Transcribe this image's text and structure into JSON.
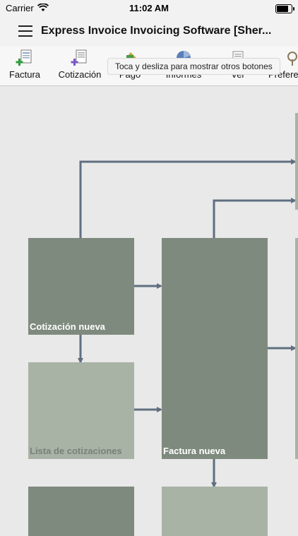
{
  "status_bar": {
    "carrier": "Carrier",
    "time": "11:02 AM",
    "battery_level": 0.9
  },
  "app": {
    "title": "Express Invoice Invoicing Software [Sher..."
  },
  "toolbar": {
    "buttons": [
      {
        "label": "Factura",
        "icon": "invoice-plus-icon"
      },
      {
        "label": "Cotización",
        "icon": "quote-plus-icon"
      },
      {
        "label": "Pago",
        "icon": "payment-icon"
      },
      {
        "label": "Informes",
        "icon": "reports-icon"
      },
      {
        "label": "Ver",
        "icon": "view-icon"
      },
      {
        "label": "Prefere",
        "icon": "preferences-icon"
      }
    ],
    "tooltip": "Toca y desliza para mostrar otros botones"
  },
  "flow": {
    "nodes": [
      {
        "label": "Cotización nueva",
        "style": "dark"
      },
      {
        "label": "Lista de cotizaciones",
        "style": "light"
      },
      {
        "label": "Factura nueva",
        "style": "dark"
      }
    ]
  },
  "colors": {
    "dark_node": "#7e8a7d",
    "light_node": "#a8b3a6",
    "connector": "#5f6f80",
    "background": "#e9e9e9"
  }
}
